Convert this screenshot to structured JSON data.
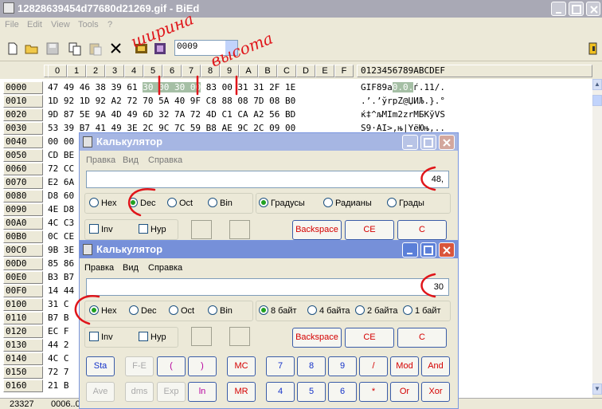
{
  "window": {
    "title": "12828639454d77680d21269.gif - BiEd"
  },
  "menu": [
    "File",
    "Edit",
    "View",
    "Tools",
    "?"
  ],
  "toolbar": {
    "offset_value": "0009"
  },
  "hex": {
    "col_headers": [
      "0",
      "1",
      "2",
      "3",
      "4",
      "5",
      "6",
      "7",
      "8",
      "9",
      "A",
      "B",
      "C",
      "D",
      "E",
      "F"
    ],
    "ascii_header": "0123456789ABCDEF",
    "rows": [
      {
        "offset": "0000",
        "hex_pre": "47 49 46 38 39 61 ",
        "hex_hl": "30 00 30 00",
        "hex_post": " 83 00 31 31 2F 1E",
        "asc_pre": "GIF89a",
        "asc_hl": "0.0.",
        "asc_post": "ѓ.11/."
      },
      {
        "offset": "0010",
        "hex": "1D 92 1D 92 A2 72 70 5A 40 9F C8 88 08 7D 08 B0",
        "asc": ".’.’ўrpZ@ЏИЉ.}.°"
      },
      {
        "offset": "0020",
        "hex": "9D 87 5E 9A 4D 49 6D 32 7A 72 4D C1 CA A2 56 BD",
        "asc": "ќ‡^љMIm2zrMБКўVЅ"
      },
      {
        "offset": "0030",
        "hex": "53 39 B7 41 49 3E 2C 9C 7C 59 B8 AE 9C 2C 09 00",
        "asc": "S9·AI>,њ|YёЮњ,.."
      },
      {
        "offset": "0040",
        "hex": "00 00",
        "asc": ""
      },
      {
        "offset": "0050",
        "hex": "CD BE",
        "asc": ""
      },
      {
        "offset": "0060",
        "hex": "72 CC",
        "asc": ""
      },
      {
        "offset": "0070",
        "hex": "E2 6A",
        "asc": ""
      },
      {
        "offset": "0080",
        "hex": "D8 60",
        "asc": ""
      },
      {
        "offset": "0090",
        "hex": "4E D8",
        "asc": ""
      },
      {
        "offset": "00A0",
        "hex": "4C C3",
        "asc": ""
      },
      {
        "offset": "00B0",
        "hex": "0C CE",
        "asc": ""
      },
      {
        "offset": "00C0",
        "hex": "9B 3E",
        "asc": ""
      },
      {
        "offset": "00D0",
        "hex": "85 86",
        "asc": ""
      },
      {
        "offset": "00E0",
        "hex": "B3 B7",
        "asc": ""
      },
      {
        "offset": "00F0",
        "hex": "14 44",
        "asc": ""
      },
      {
        "offset": "0100",
        "hex": "31 C",
        "asc": ""
      },
      {
        "offset": "0110",
        "hex": "B7 B",
        "asc": ""
      },
      {
        "offset": "0120",
        "hex": "EC F",
        "asc": ""
      },
      {
        "offset": "0130",
        "hex": "44 2",
        "asc": ""
      },
      {
        "offset": "0140",
        "hex": "4C C",
        "asc": ""
      },
      {
        "offset": "0150",
        "hex": "72 7",
        "asc": ""
      },
      {
        "offset": "0160",
        "hex": "21 B",
        "asc": ""
      }
    ]
  },
  "status": {
    "size": "23327",
    "pos": "0006..0"
  },
  "calc1": {
    "title": "Калькулятор",
    "menu": [
      "Правка",
      "Вид",
      "Справка"
    ],
    "display": "48,",
    "radix": [
      "Hex",
      "Dec",
      "Oct",
      "Bin"
    ],
    "units": [
      "Градусы",
      "Радианы",
      "Грады"
    ],
    "inv": "Inv",
    "hyp": "Hyp",
    "backspace": "Backspace",
    "ce": "CE",
    "c": "C"
  },
  "calc2": {
    "title": "Калькулятор",
    "menu": [
      "Правка",
      "Вид",
      "Справка"
    ],
    "display": "30",
    "radix": [
      "Hex",
      "Dec",
      "Oct",
      "Bin"
    ],
    "sizes": [
      "8 байт",
      "4 байта",
      "2 байта",
      "1 байт"
    ],
    "inv": "Inv",
    "hyp": "Hyp",
    "backspace": "Backspace",
    "ce": "CE",
    "c": "C",
    "keys_row1": [
      "Sta",
      "F-E",
      "(",
      ")",
      "MC",
      "7",
      "8",
      "9",
      "/",
      "Mod",
      "And"
    ],
    "keys_row2": [
      "Ave",
      "dms",
      "Exp",
      "ln",
      "MR",
      "4",
      "5",
      "6",
      "*",
      "Or",
      "Xor"
    ]
  },
  "annotations": {
    "width_label": "ширина",
    "height_label": "высота"
  },
  "colors": {
    "ink": "#e0151a",
    "highlight": "#a5bfa5",
    "title_active": "#7690d9"
  }
}
